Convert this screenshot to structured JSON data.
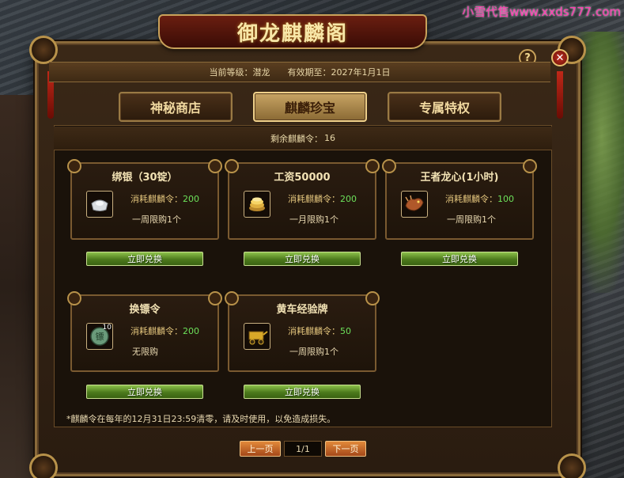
{
  "watermark": "小雪代售www.xxds777.com",
  "window": {
    "title": "御龙麒麟阁",
    "help_icon": "question-icon",
    "close_icon": "close-icon"
  },
  "header": {
    "level_label": "当前等级：潜龙",
    "expiry_label": "有效期至：2027年1月1日"
  },
  "tabs": [
    {
      "label": "神秘商店",
      "active": false
    },
    {
      "label": "麒麟珍宝",
      "active": true
    },
    {
      "label": "专属特权",
      "active": false
    }
  ],
  "remaining": {
    "label": "剩余麒麟令：",
    "value": "16"
  },
  "items": [
    {
      "title": "绑银（30锭）",
      "icon": "silver-ingot-icon",
      "cost_label": "消耗麒麟令：",
      "cost": "200",
      "limit": "一周限购1个",
      "button": "立即兑换"
    },
    {
      "title": "工资50000",
      "icon": "gold-coins-icon",
      "cost_label": "消耗麒麟令：",
      "cost": "200",
      "limit": "一月限购1个",
      "button": "立即兑换"
    },
    {
      "title": "王者龙心(1小时)",
      "icon": "dragon-heart-icon",
      "cost_label": "消耗麒麟令：",
      "cost": "100",
      "limit": "一周限购1个",
      "button": "立即兑换"
    },
    {
      "title": "换镖令",
      "icon": "escort-token-icon",
      "qty": "10",
      "cost_label": "消耗麒麟令：",
      "cost": "200",
      "limit": "无限购",
      "button": "立即兑换"
    },
    {
      "title": "黄车经验牌",
      "icon": "yellow-cart-icon",
      "cost_label": "消耗麒麟令：",
      "cost": "50",
      "limit": "一周限购1个",
      "button": "立即兑换"
    }
  ],
  "notice": "*麒麟令在每年的12月31日23:59清零，请及时使用，以免造成损失。",
  "pager": {
    "prev": "上一页",
    "page": "1/1",
    "next": "下一页"
  },
  "colors": {
    "accent_gold": "#c9a25a",
    "cost_green": "#6ce05a",
    "button_green": "#4c7a1c",
    "pager_orange": "#a4481a"
  }
}
